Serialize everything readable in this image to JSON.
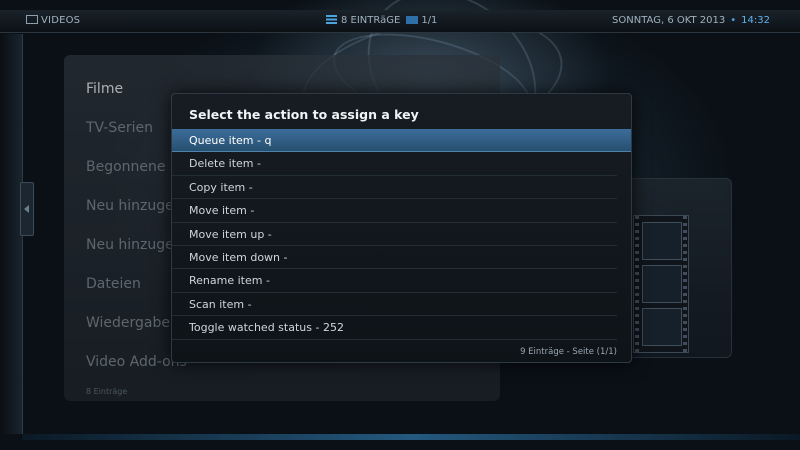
{
  "header": {
    "section": "VIDEOS",
    "items_count": "8 EINTRäGE",
    "page": "1/1",
    "date": "SONNTAG, 6 OKT 2013",
    "time": "14:32"
  },
  "menu": {
    "items": [
      {
        "label": "Filme"
      },
      {
        "label": "TV-Serien"
      },
      {
        "label": "Begonnene Se"
      },
      {
        "label": "Neu hinzugef"
      },
      {
        "label": "Neu hinzugef"
      },
      {
        "label": "Dateien"
      },
      {
        "label": "Wiedergabeli"
      },
      {
        "label": "Video Add-ons"
      }
    ],
    "count_label": "8 Einträge"
  },
  "dialog": {
    "title": "Select the action to assign a key",
    "actions": [
      {
        "label": "Queue item - q"
      },
      {
        "label": "Delete item -"
      },
      {
        "label": "Copy item -"
      },
      {
        "label": "Move item -"
      },
      {
        "label": "Move item up -"
      },
      {
        "label": "Move item down -"
      },
      {
        "label": "Rename item -"
      },
      {
        "label": "Scan item -"
      },
      {
        "label": "Toggle watched status - 252"
      }
    ],
    "footer": "9 Einträge - Seite (1/1)"
  },
  "icons": {
    "section": "monitor-icon",
    "list": "list-icon",
    "page": "page-icon",
    "film": "film-strip-icon"
  },
  "colors": {
    "accent": "#4aa4e0",
    "selection": "#3c6d9a"
  }
}
